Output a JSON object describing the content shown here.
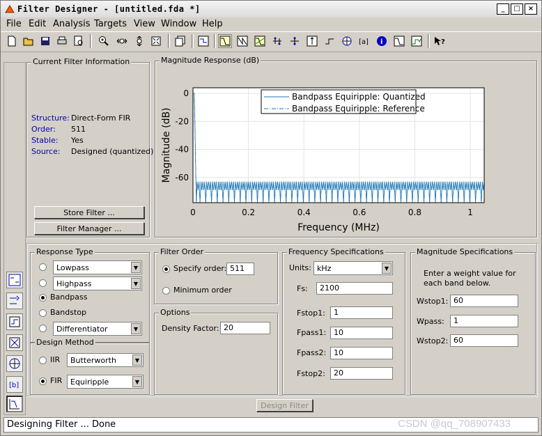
{
  "window": {
    "title": "Filter Designer -  [untitled.fda *]"
  },
  "menu": [
    "File",
    "Edit",
    "Analysis",
    "Targets",
    "View",
    "Window",
    "Help"
  ],
  "toolbar": [
    "new-icon",
    "open-icon",
    "save-icon",
    "print-icon",
    "print-preview-icon",
    "zoom-in-icon",
    "zoom-x-icon",
    "zoom-y-icon",
    "full-view-icon",
    "new-figure-icon",
    "filter-specs-icon",
    "magnitude-response-icon",
    "phase-response-icon",
    "mag-phase-icon",
    "group-delay-icon",
    "phase-delay-icon",
    "impulse-response-icon",
    "step-response-icon",
    "pole-zero-icon",
    "filter-coeffs-icon",
    "filter-info-icon",
    "magnitude-estimate-icon",
    "round-off-noise-icon",
    "whats-this-icon"
  ],
  "current_filter": {
    "title": "Current Filter Information",
    "rows": [
      {
        "label": "Structure:",
        "value": "Direct-Form FIR"
      },
      {
        "label": "Order:",
        "value": "511"
      },
      {
        "label": "Stable:",
        "value": "Yes"
      },
      {
        "label": "Source:",
        "value": "Designed (quantized)"
      }
    ],
    "store_button": "Store Filter ...",
    "manager_button": "Filter Manager ..."
  },
  "plot": {
    "panel_title": "Magnitude Response (dB)",
    "legend": [
      "Bandpass Equiripple: Quantized",
      "Bandpass Equiripple: Reference"
    ],
    "color": "#1f77b4"
  },
  "chart_data": {
    "type": "line",
    "title": "",
    "xlabel": "Frequency (MHz)",
    "ylabel": "Magnitude (dB)",
    "xlim": [
      0,
      1.05
    ],
    "ylim": [
      -78,
      4
    ],
    "xticks": [
      "0",
      "0.2",
      "0.4",
      "0.6",
      "0.8",
      "1"
    ],
    "yticks": [
      "0",
      "-20",
      "-40",
      "-60"
    ],
    "grid": true,
    "legend_position": "top",
    "series": [
      {
        "name": "Bandpass Equiripple: Quantized",
        "style": "solid",
        "passband": {
          "x": [
            0.0005,
            0.005
          ],
          "value": 0
        },
        "stopband_level": [
          -63,
          -69
        ]
      },
      {
        "name": "Bandpass Equiripple: Reference",
        "style": "dash-dot",
        "passband": {
          "x": [
            0.0005,
            0.005
          ],
          "value": 0
        },
        "stopband_level": [
          -63,
          -69
        ]
      }
    ]
  },
  "response_type": {
    "title": "Response Type",
    "options": [
      "Lowpass",
      "Highpass",
      "Bandpass",
      "Bandstop",
      "Differentiator"
    ],
    "selected": "Bandpass"
  },
  "design_method": {
    "title": "Design Method",
    "iir_label": "IIR",
    "iir_value": "Butterworth",
    "fir_label": "FIR",
    "fir_value": "Equiripple",
    "selected": "FIR"
  },
  "filter_order": {
    "title": "Filter Order",
    "specify_label": "Specify order:",
    "specify_value": "511",
    "minimum_label": "Minimum order",
    "selected": "specify"
  },
  "options": {
    "title": "Options",
    "density_label": "Density Factor:",
    "density_value": "20"
  },
  "freq_specs": {
    "title": "Frequency Specifications",
    "units_label": "Units:",
    "units_value": "kHz",
    "fields": [
      {
        "label": "Fs:",
        "value": "2100"
      },
      {
        "label": "Fstop1:",
        "value": "1"
      },
      {
        "label": "Fpass1:",
        "value": "10"
      },
      {
        "label": "Fpass2:",
        "value": "10"
      },
      {
        "label": "Fstop2:",
        "value": "20"
      }
    ]
  },
  "mag_specs": {
    "title": "Magnitude Specifications",
    "hint": "Enter a weight value for each band below.",
    "fields": [
      {
        "label": "Wstop1:",
        "value": "60"
      },
      {
        "label": "Wpass:",
        "value": "1"
      },
      {
        "label": "Wstop2:",
        "value": "60"
      }
    ]
  },
  "design_button": "Design Filter",
  "status": "Designing Filter ... Done",
  "watermark": "CSDN @qq_708907433"
}
